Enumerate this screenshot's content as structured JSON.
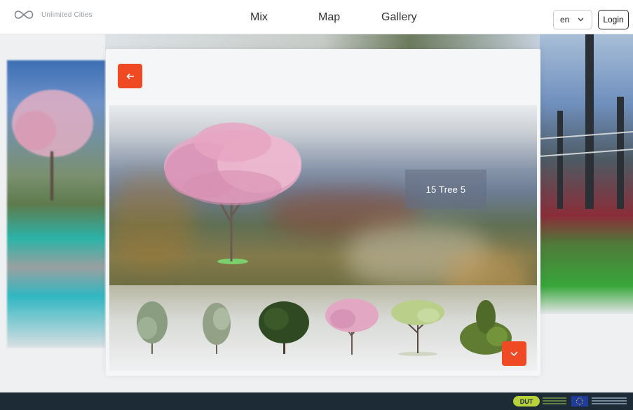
{
  "header": {
    "logo_text": "Unlimited Cities",
    "nav": [
      "Mix",
      "Map",
      "Gallery"
    ],
    "language": "en",
    "login_label": "Login"
  },
  "modal": {
    "back_icon": "arrow-left-icon",
    "confirm_icon": "check-icon",
    "selected_tree_label": "15 Tree 5",
    "tree_options": [
      {
        "name": "tree-1",
        "color": "#8a9d80"
      },
      {
        "name": "tree-2",
        "color": "#93a287"
      },
      {
        "name": "tree-3",
        "color": "#2f4a22"
      },
      {
        "name": "tree-4",
        "color": "#e2a7c2"
      },
      {
        "name": "tree-5",
        "color": "#b9cf8a"
      },
      {
        "name": "tree-6",
        "color": "#5f7c32"
      }
    ]
  },
  "colors": {
    "accent": "#ef4a23",
    "footer": "#1d2b36"
  },
  "footer": {
    "dut_label": "DUT"
  }
}
